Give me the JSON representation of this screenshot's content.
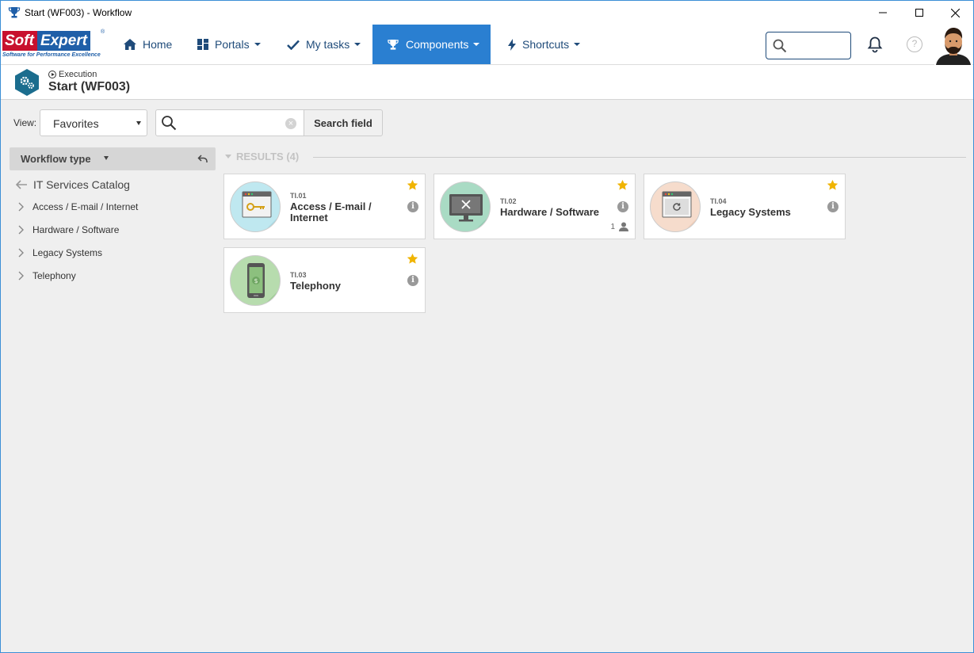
{
  "window": {
    "title": "Start (WF003) - Workflow"
  },
  "logo": {
    "soft": "Soft",
    "expert": "Expert",
    "tagline": "Software for Performance Excellence",
    "reg": "®"
  },
  "nav": {
    "home": "Home",
    "portals": "Portals",
    "my_tasks": "My tasks",
    "components": "Components",
    "shortcuts": "Shortcuts"
  },
  "header": {
    "breadcrumb": "Execution",
    "title": "Start (WF003)"
  },
  "filter": {
    "view_label": "View:",
    "view_value": "Favorites",
    "search_value": "",
    "search_button": "Search field"
  },
  "sidebar": {
    "header": "Workflow type",
    "catalog": "IT Services Catalog",
    "items": [
      {
        "label": "Access / E-mail / Internet"
      },
      {
        "label": "Hardware / Software"
      },
      {
        "label": "Legacy Systems"
      },
      {
        "label": "Telephony"
      }
    ]
  },
  "results": {
    "label": "RESULTS (4)",
    "cards": [
      {
        "code": "TI.01",
        "name": "Access / E-mail / Internet",
        "favorite": true,
        "icon": "key-window-icon",
        "color": "#bfe8f0"
      },
      {
        "code": "TI.02",
        "name": "Hardware / Software",
        "favorite": true,
        "icon": "monitor-tools-icon",
        "color": "#a9dbc4",
        "users": "1"
      },
      {
        "code": "TI.04",
        "name": "Legacy Systems",
        "favorite": true,
        "icon": "legacy-window-icon",
        "color": "#f6dccc"
      },
      {
        "code": "TI.03",
        "name": "Telephony",
        "favorite": true,
        "icon": "phone-icon",
        "color": "#b7dcae"
      }
    ]
  },
  "colors": {
    "accent": "#2a7fd1",
    "nav_text": "#1f4b7a",
    "star": "#f0b400",
    "logo_red": "#c8102e",
    "logo_blue": "#1f5fa8"
  }
}
